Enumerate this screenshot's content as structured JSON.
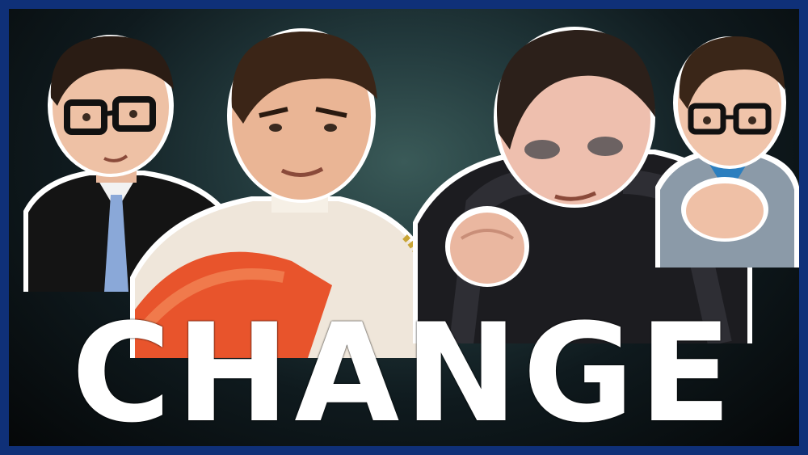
{
  "thumbnail": {
    "title_text": "CHANGE",
    "frame_color": "#0f3078",
    "background_color": "#1c2e30",
    "title_color": "#ffffff",
    "figures": [
      {
        "name": "left-character-glasses-tie",
        "icon": "person-glasses-tie"
      },
      {
        "name": "center-character-prince",
        "icon": "person-prince-sash"
      },
      {
        "name": "right-character-dark-robe",
        "icon": "person-dark-robe-fist"
      },
      {
        "name": "far-right-character-nervous",
        "icon": "person-glasses-nervous"
      }
    ]
  }
}
